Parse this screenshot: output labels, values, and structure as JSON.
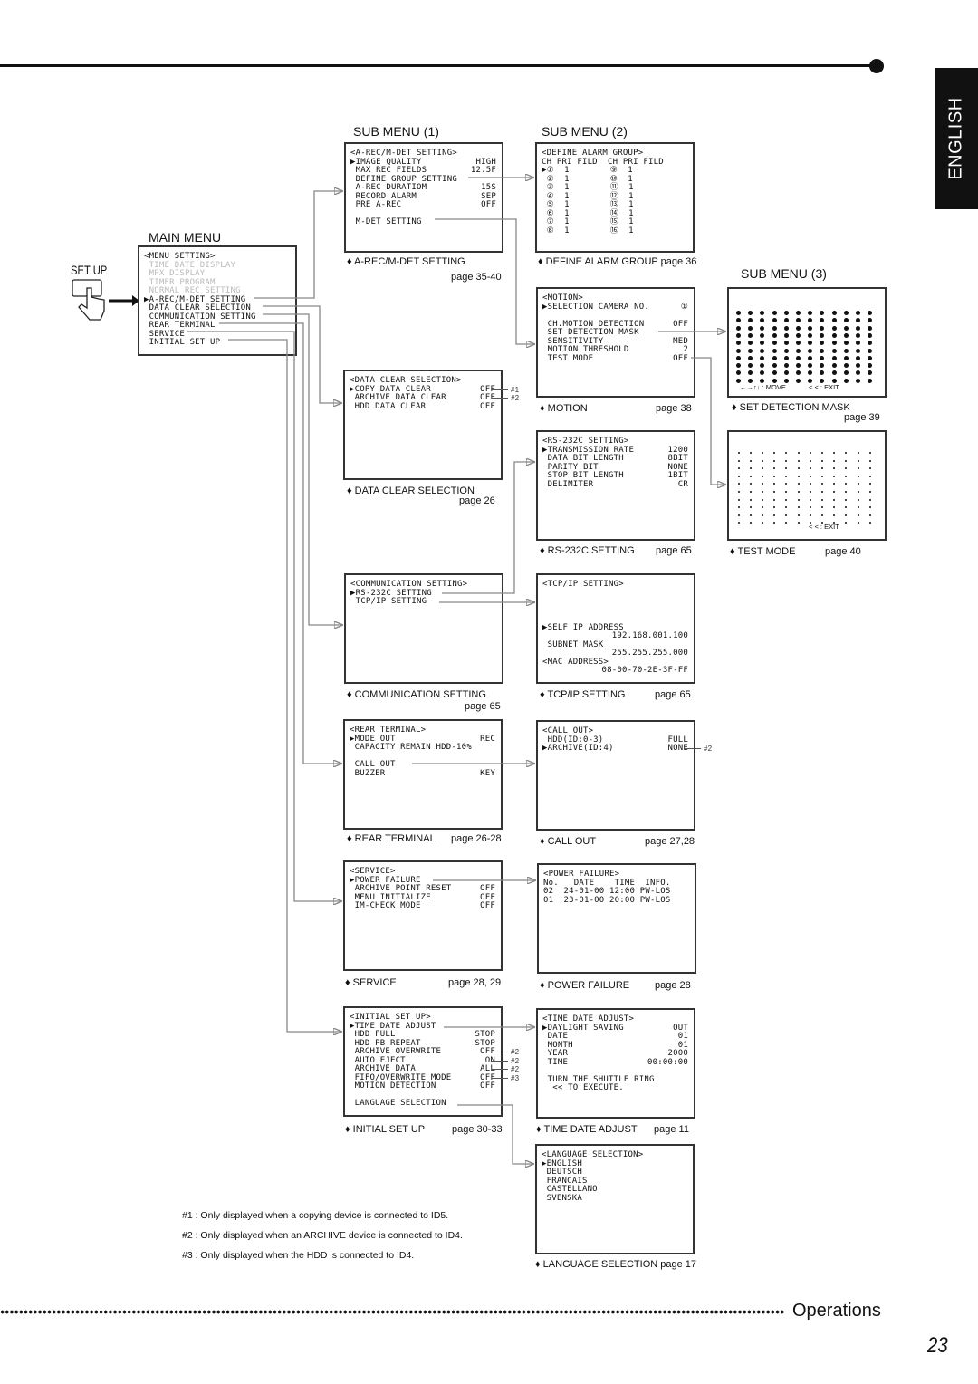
{
  "tab_label": "ENGLISH",
  "setup_label": "SET UP",
  "section_titles": {
    "main": "MAIN MENU",
    "sub1": "SUB MENU (1)",
    "sub2": "SUB MENU (2)",
    "sub3": "SUB MENU (3)"
  },
  "boxes": {
    "main": {
      "caption": "",
      "page": "",
      "lines": [
        {
          "l": "<MENU SETTING>"
        },
        {
          "l": " TIME DATE DISPLAY",
          "dim": true
        },
        {
          "l": " MPX DISPLAY",
          "dim": true
        },
        {
          "l": " TIMER PROGRAM",
          "dim": true
        },
        {
          "l": " NORMAL REC SETTING",
          "dim": true
        },
        {
          "l": "▶A-REC/M-DET SETTING"
        },
        {
          "l": " DATA CLEAR SELECTION"
        },
        {
          "l": " COMMUNICATION SETTING"
        },
        {
          "l": " REAR TERMINAL"
        },
        {
          "l": " SERVICE"
        },
        {
          "l": " INITIAL SET UP"
        }
      ]
    },
    "arec": {
      "caption": "♦ A-REC/M-DET SETTING",
      "page": "page 35-40",
      "lines": [
        {
          "l": "<A-REC/M-DET SETTING>"
        },
        {
          "l": "▶IMAGE QUALITY",
          "v": "HIGH"
        },
        {
          "l": " MAX REC FIELDS",
          "v": "12.5F"
        },
        {
          "l": " DEFINE GROUP SETTING"
        },
        {
          "l": " A-REC DURATIOM",
          "v": "15S"
        },
        {
          "l": " RECORD ALARM",
          "v": "SEP"
        },
        {
          "l": " PRE A-REC",
          "v": "OFF"
        },
        {
          "l": ""
        },
        {
          "l": " M-DET SETTING"
        }
      ]
    },
    "dag": {
      "caption": "♦ DEFINE ALARM GROUP   page 36",
      "page": "",
      "lines": [
        {
          "l": "<DEFINE ALARM GROUP>"
        },
        {
          "l": "CH PRI FILD  CH PRI FILD"
        },
        {
          "l": "▶①  1        ⑨  1"
        },
        {
          "l": " ②  1        ⑩  1"
        },
        {
          "l": " ③  1        ⑪  1"
        },
        {
          "l": " ④  1        ⑫  1"
        },
        {
          "l": " ⑤  1        ⑬  1"
        },
        {
          "l": " ⑥  1        ⑭  1"
        },
        {
          "l": " ⑦  1        ⑮  1"
        },
        {
          "l": " ⑧  1        ⑯  1"
        }
      ]
    },
    "motion": {
      "caption": "♦ MOTION",
      "page": "page 38",
      "lines": [
        {
          "l": "<MOTION>"
        },
        {
          "l": "▶SELECTION CAMERA NO.",
          "v": "①"
        },
        {
          "l": ""
        },
        {
          "l": " CH.MOTION DETECTION",
          "v": "OFF"
        },
        {
          "l": " SET DETECTION MASK"
        },
        {
          "l": " SENSITIVITY",
          "v": "MED"
        },
        {
          "l": " MOTION THRESHOLD",
          "v": "2"
        },
        {
          "l": " TEST MODE",
          "v": "OFF"
        }
      ]
    },
    "mask": {
      "caption": "♦ SET DETECTION MASK",
      "page": "page 39",
      "legend_move": "←→↑↓ : MOVE",
      "legend_exit": "< < : EXIT",
      "grid": {
        "cols": 12,
        "rows": 10
      },
      "lines": []
    },
    "dcs": {
      "caption": "♦ DATA CLEAR SELECTION",
      "page": "page 26",
      "lines": [
        {
          "l": "<DATA CLEAR SELECTION>"
        },
        {
          "l": "▶COPY DATA CLEAR",
          "v": "OFF",
          "note": "#1"
        },
        {
          "l": " ARCHIVE DATA CLEAR",
          "v": "OFF",
          "note": "#2"
        },
        {
          "l": " HDD DATA CLEAR",
          "v": "OFF"
        }
      ]
    },
    "rs": {
      "caption": "♦ RS-232C SETTING",
      "page": "page 65",
      "lines": [
        {
          "l": "<RS-232C SETTING>"
        },
        {
          "l": "▶TRANSMISSION RATE",
          "v": "1200"
        },
        {
          "l": " DATA BIT LENGTH",
          "v": "8BIT"
        },
        {
          "l": " PARITY BIT",
          "v": "NONE"
        },
        {
          "l": " STOP BIT LENGTH",
          "v": "1BIT"
        },
        {
          "l": " DELIMITER",
          "v": "CR"
        }
      ]
    },
    "test": {
      "caption": "♦ TEST MODE",
      "page": "page 40",
      "legend_exit": "< < : EXIT",
      "grid": {
        "cols": 12,
        "rows": 10
      },
      "lines": []
    },
    "comm": {
      "caption": "♦ COMMUNICATION SETTING",
      "page": "page 65",
      "lines": [
        {
          "l": "<COMMUNICATION SETTING>"
        },
        {
          "l": "▶RS-232C SETTING"
        },
        {
          "l": " TCP/IP SETTING"
        }
      ]
    },
    "tcp": {
      "caption": "♦ TCP/IP SETTING",
      "page": "page 65",
      "lines": [
        {
          "l": "<TCP/IP SETTING>"
        },
        {
          "l": ""
        },
        {
          "l": ""
        },
        {
          "l": ""
        },
        {
          "l": ""
        },
        {
          "l": "▶SELF IP ADDRESS"
        },
        {
          "l": "",
          "v": "192.168.001.100"
        },
        {
          "l": " SUBNET MASK"
        },
        {
          "l": "",
          "v": "255.255.255.000"
        },
        {
          "l": "<MAC ADDRESS>"
        },
        {
          "l": "",
          "v": "08-00-70-2E-3F-FF"
        }
      ]
    },
    "rear": {
      "caption": "♦ REAR TERMINAL",
      "page": "page 26-28",
      "lines": [
        {
          "l": "<REAR TERMINAL>"
        },
        {
          "l": "▶MODE OUT",
          "v": "REC"
        },
        {
          "l": " CAPACITY REMAIN HDD-10%"
        },
        {
          "l": ""
        },
        {
          "l": " CALL OUT"
        },
        {
          "l": " BUZZER",
          "v": "KEY"
        }
      ]
    },
    "call": {
      "caption": "♦ CALL OUT",
      "page": "page 27,28",
      "lines": [
        {
          "l": "<CALL OUT>"
        },
        {
          "l": " HDD(ID:0-3)",
          "v": "FULL"
        },
        {
          "l": "▶ARCHIVE(ID:4)",
          "v": "NONE",
          "note": "#2"
        }
      ]
    },
    "service": {
      "caption": "♦ SERVICE",
      "page": "page 28, 29",
      "lines": [
        {
          "l": "<SERVICE>"
        },
        {
          "l": "▶POWER FAILURE"
        },
        {
          "l": " ARCHIVE POINT RESET",
          "v": "OFF"
        },
        {
          "l": " MENU INITIALIZE",
          "v": "OFF"
        },
        {
          "l": " IM-CHECK MODE",
          "v": "OFF"
        }
      ]
    },
    "pf": {
      "caption": "♦ POWER FAILURE",
      "page": "page 28",
      "lines": [
        {
          "l": "<POWER FAILURE>"
        },
        {
          "l": "No.   DATE    TIME  INFO."
        },
        {
          "l": "02  24-01-00 12:00 PW-LOS"
        },
        {
          "l": "01  23-01-00 20:00 PW-LOS"
        }
      ]
    },
    "init": {
      "caption": "♦ INITIAL SET UP",
      "page": "page 30-33",
      "lines": [
        {
          "l": "<INITIAL SET UP>"
        },
        {
          "l": "▶TIME DATE ADJUST"
        },
        {
          "l": " HDD FULL",
          "v": "STOP"
        },
        {
          "l": " HDD PB REPEAT",
          "v": "STOP"
        },
        {
          "l": " ARCHIVE OVERWRITE",
          "v": "OFF",
          "note": "#2"
        },
        {
          "l": " AUTO EJECT",
          "v": "ON",
          "note": "#2"
        },
        {
          "l": " ARCHIVE DATA",
          "v": "ALL",
          "note": "#2"
        },
        {
          "l": " FIFO/OVERWRITE MODE",
          "v": "OFF",
          "note": "#3"
        },
        {
          "l": " MOTION DETECTION",
          "v": "OFF"
        },
        {
          "l": ""
        },
        {
          "l": " LANGUAGE SELECTION"
        }
      ]
    },
    "tda": {
      "caption": "♦ TIME DATE ADJUST",
      "page": "page 11",
      "lines": [
        {
          "l": "<TIME DATE ADJUST>"
        },
        {
          "l": "▶DAYLIGHT SAVING",
          "v": "OUT"
        },
        {
          "l": " DATE",
          "v": "01"
        },
        {
          "l": " MONTH",
          "v": "01"
        },
        {
          "l": " YEAR",
          "v": "2000"
        },
        {
          "l": " TIME",
          "v": "00:00:00"
        },
        {
          "l": ""
        },
        {
          "l": " TURN THE SHUTTLE RING"
        },
        {
          "l": "  << TO EXECUTE."
        }
      ]
    },
    "lang": {
      "caption": "♦ LANGUAGE SELECTION  page 17",
      "page": "",
      "lines": [
        {
          "l": "<LANGUAGE SELECTION>"
        },
        {
          "l": "▶ENGLISH"
        },
        {
          "l": " DEUTSCH"
        },
        {
          "l": " FRANCAIS"
        },
        {
          "l": " CASTELLANO"
        },
        {
          "l": " SVENSKA"
        }
      ]
    }
  },
  "footnotes": [
    "#1 : Only displayed when a copying device is connected to ID5.",
    "#2 : Only displayed when an ARCHIVE device is connected to ID4.",
    "#3 : Only displayed when the HDD is connected to ID4."
  ],
  "footer": {
    "section": "Operations",
    "page_number": "23"
  },
  "colors": {
    "connector": "#888888",
    "text": "#111111",
    "disabled_text": "#bbbbbb"
  }
}
